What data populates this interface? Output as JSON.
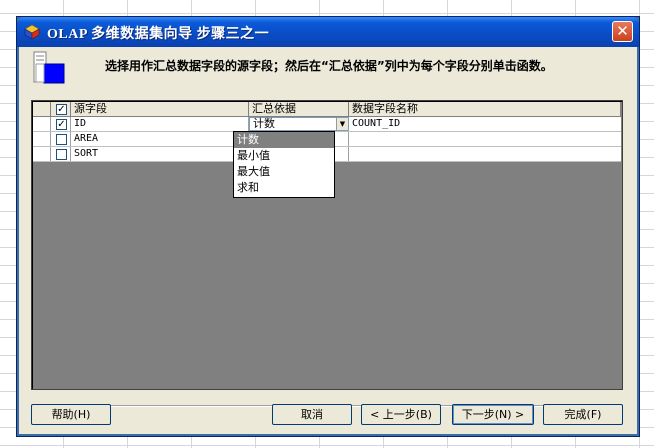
{
  "window": {
    "title": "OLAP 多维数据集向导 步骤三之一",
    "close_label": "✕"
  },
  "header": {
    "instruction": "选择用作汇总数据字段的源字段；然后在“汇总依据”列中为每个字段分别单击函数。"
  },
  "grid": {
    "columns": {
      "source_field": "源字段",
      "summary_by": "汇总依据",
      "data_field_name": "数据字段名称"
    },
    "header_checked": true,
    "rows": [
      {
        "checked": true,
        "source": "ID",
        "summary": "计数",
        "name": "COUNT_ID"
      },
      {
        "checked": false,
        "source": "AREA",
        "summary": "",
        "name": ""
      },
      {
        "checked": false,
        "source": "SORT",
        "summary": "",
        "name": ""
      }
    ]
  },
  "dropdown": {
    "options": [
      "计数",
      "最小值",
      "最大值",
      "求和"
    ],
    "selected": "计数"
  },
  "buttons": {
    "help": "帮助(H)",
    "cancel": "取消",
    "back": "< 上一步(B)",
    "next": "下一步(N) >",
    "finish": "完成(F)"
  },
  "colors": {
    "title_bar": "#0a4cc4",
    "dialog_bg": "#ece9d8",
    "grid_empty": "#808080",
    "selection": "#808080"
  }
}
